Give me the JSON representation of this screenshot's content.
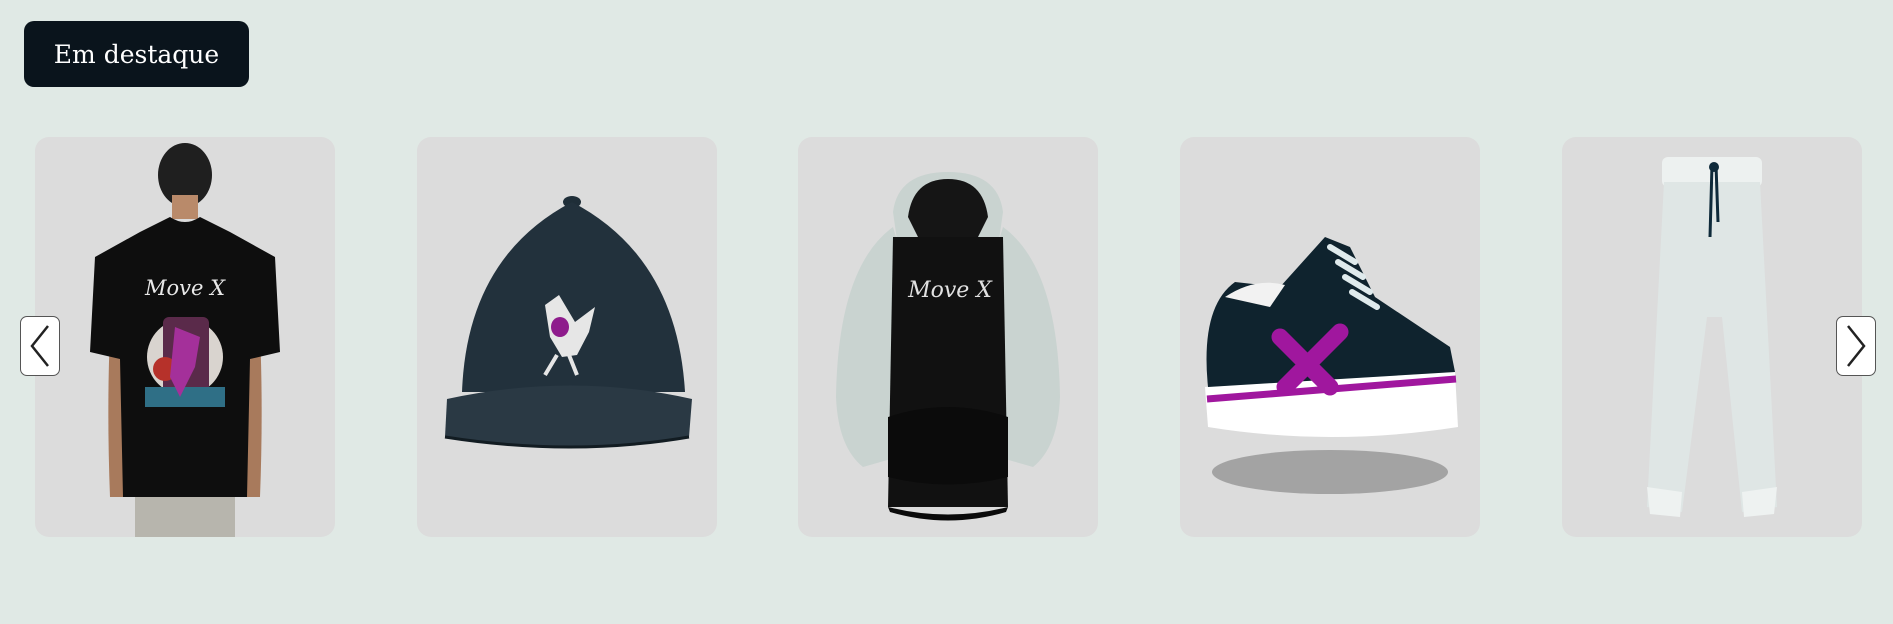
{
  "section": {
    "title": "Em destaque"
  },
  "carousel": {
    "prev_icon": "chevron-left-icon",
    "next_icon": "chevron-right-icon",
    "products": [
      {
        "image": "black-tshirt",
        "print_text": "Move X"
      },
      {
        "image": "navy-cap"
      },
      {
        "image": "black-white-hoodie",
        "print_text": "Move X"
      },
      {
        "image": "navy-sneaker"
      },
      {
        "image": "white-sweatpants"
      }
    ]
  },
  "colors": {
    "background": "#e0e9e5",
    "badge": "#0a141c",
    "card": "#dcdcdc",
    "accent": "#a0179e"
  }
}
